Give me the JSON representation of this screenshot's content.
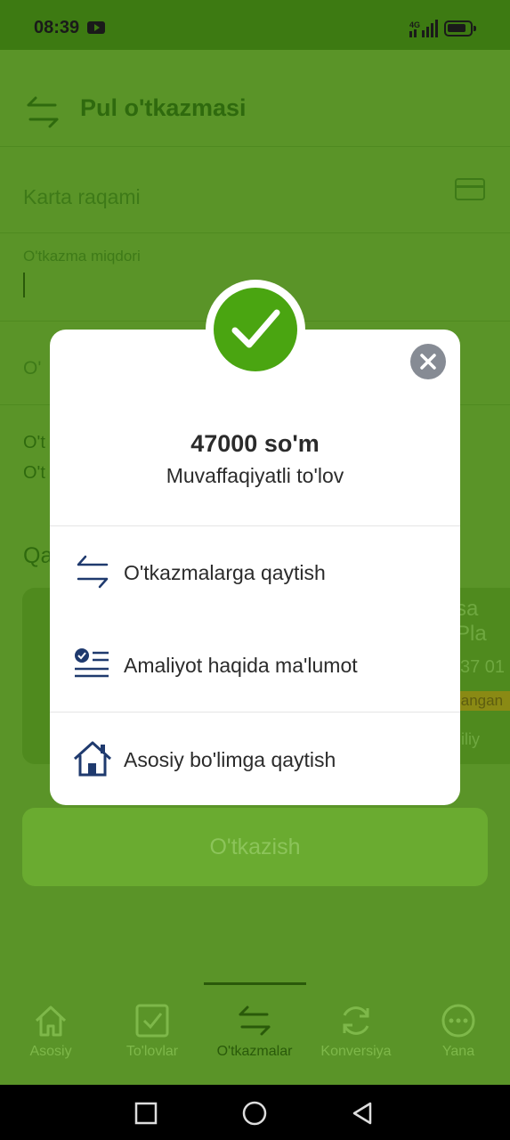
{
  "status_bar": {
    "time": "08:39",
    "network": "4G"
  },
  "header": {
    "title": "Pul o'tkazmasi"
  },
  "form": {
    "card_placeholder": "Karta raqami",
    "amount_label": "O'tkazma miqdori",
    "partial_field": "O'",
    "partial_line1": "O't",
    "partial_line2": "O't",
    "partial_section": "Qa"
  },
  "card": {
    "name_fragment": "sa Pla",
    "number_fragment": "37 01",
    "band_fragment": "langan",
    "foot_fragment": "iliy"
  },
  "transfer_button": {
    "label": "O'tkazish"
  },
  "modal": {
    "amount": "47000 so'm",
    "status": "Muvaffaqiyatli to'lov",
    "actions": [
      {
        "label": "O'tkazmalarga qaytish",
        "icon": "transfer-arrows-icon"
      },
      {
        "label": "Amaliyot haqida ma'lumot",
        "icon": "details-list-icon"
      },
      {
        "label": "Asosiy bo'limga qaytish",
        "icon": "home-icon"
      }
    ]
  },
  "bottom_nav": {
    "items": [
      {
        "label": "Asosiy",
        "icon": "home-icon"
      },
      {
        "label": "To'lovlar",
        "icon": "checkbox-icon"
      },
      {
        "label": "O'tkazmalar",
        "icon": "transfer-arrows-icon",
        "active": true
      },
      {
        "label": "Konversiya",
        "icon": "refresh-icon"
      },
      {
        "label": "Yana",
        "icon": "more-icon"
      }
    ]
  },
  "colors": {
    "brand_green": "#4aa511",
    "overlay_green": "#5a9428",
    "icon_navy": "#1f3a6e"
  }
}
